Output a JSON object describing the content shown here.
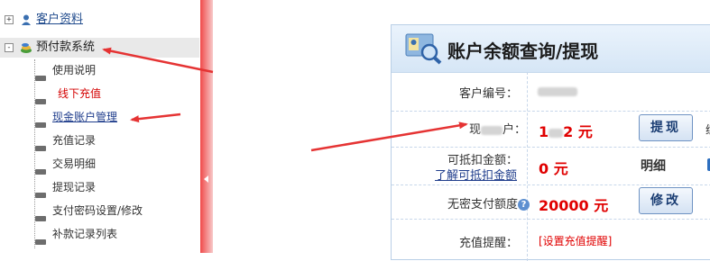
{
  "tree": {
    "top_item": {
      "label": "客户资料",
      "toggle": "+",
      "icon": "user-icon"
    },
    "open_item": {
      "label": "预付款系统",
      "toggle": "-",
      "icon": "folder-coins-icon"
    },
    "leaves": [
      {
        "label": "使用说明"
      },
      {
        "label": "线下充值"
      },
      {
        "label": "现金账户管理"
      },
      {
        "label": "充值记录"
      },
      {
        "label": "交易明细"
      },
      {
        "label": "提现记录"
      },
      {
        "label": "支付密码设置/修改"
      },
      {
        "label": "补款记录列表"
      }
    ]
  },
  "panel": {
    "title": "账户余额查询/提现",
    "rows": {
      "customer_no": {
        "label": "客户编号："
      },
      "cash_balance": {
        "label_prefix": "现",
        "label_suffix": "户：",
        "value_prefix": "1",
        "value_suffix": "2 元",
        "button": "提现",
        "cut_text": "练"
      },
      "deductible": {
        "label": "可抵扣金额：",
        "link": "了解可抵扣金额",
        "value": "0 元",
        "detail": "明细"
      },
      "no_pwd_limit": {
        "label": "无密支付额度",
        "help": "?",
        "value": "20000 元",
        "button": "修改"
      },
      "recharge_reminder": {
        "label": "充值提醒：",
        "value": "[设置充值提醒]"
      }
    }
  },
  "colors": {
    "accent_red": "#e00000",
    "arrow_red": "#e53333",
    "link_blue": "#1f3d8c",
    "splitter": "#f04a4a"
  }
}
